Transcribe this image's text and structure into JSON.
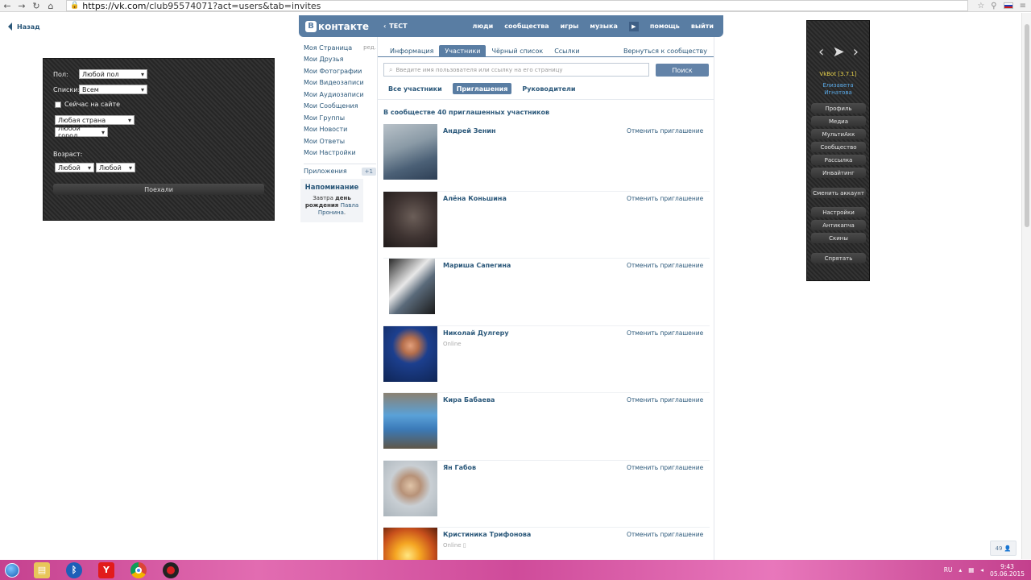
{
  "browser": {
    "url_domain": "https://vk.com",
    "url_path": "/club95574071?act=users&tab=invites"
  },
  "back": {
    "label": "Назад"
  },
  "filter": {
    "gender_label": "Пол:",
    "gender_value": "Любой пол",
    "lists_label": "Списки:",
    "lists_value": "Всем",
    "online_label": "Сейчас на сайте",
    "country_value": "Любая страна",
    "city_value": "Любой город",
    "age_label": "Возраст:",
    "age_from": "Любой",
    "age_to": "Любой",
    "go_label": "Поехали"
  },
  "vk": {
    "logo_letter": "В",
    "logo_text": "контакте",
    "group_name": "ТЕСТ",
    "nav": [
      "люди",
      "сообщества",
      "игры",
      "музыка",
      "помощь",
      "выйти"
    ],
    "menu": [
      "Моя Страница",
      "Мои Друзья",
      "Мои Фотографии",
      "Мои Видеозаписи",
      "Мои Аудиозаписи",
      "Мои Сообщения",
      "Мои Группы",
      "Мои Новости",
      "Мои Ответы",
      "Мои Настройки"
    ],
    "menu_edit": "ред.",
    "apps_label": "Приложения",
    "apps_badge": "+1",
    "reminder": {
      "title": "Напоминание",
      "line1_pre": "Завтра ",
      "line1_bold": "день",
      "line2_bold": "рождения ",
      "line2_link": "Павла",
      "line3_link": "Пронина",
      "line3_end": "."
    }
  },
  "main": {
    "tabs": [
      "Информация",
      "Участники",
      "Чёрный список",
      "Ссылки"
    ],
    "back_to_group": "Вернуться к сообществу",
    "search_placeholder": "Введите имя пользователя или ссылку на его страницу",
    "search_button": "Поиск",
    "subtabs": [
      "Все участники",
      "Приглашения",
      "Руководители"
    ],
    "count_text": "В сообществе 40 приглашенных участников",
    "cancel_label": "Отменить приглашение",
    "members": [
      {
        "name": "Андрей Зенин",
        "status": ""
      },
      {
        "name": "Алёна Коньшина",
        "status": ""
      },
      {
        "name": "Мариша Сапегина",
        "status": ""
      },
      {
        "name": "Николай Дулгеру",
        "status": "Online"
      },
      {
        "name": "Кира Бабаева",
        "status": ""
      },
      {
        "name": "Ян Габов",
        "status": ""
      },
      {
        "name": "Кристиника Трифонова",
        "status": "Online ▯"
      }
    ]
  },
  "vkbot": {
    "version": "VkBot [3.7.1]",
    "user_line1": "Елизавета",
    "user_line2": "Игнатова",
    "buttons": [
      "Профиль",
      "Медиа",
      "МультиАкк",
      "Сообщество",
      "Рассылка",
      "Инвайтинг",
      "Сменить аккаунт",
      "Настройки",
      "Антикапча",
      "Скины",
      "Спрятать"
    ]
  },
  "counter": "49 👤",
  "taskbar": {
    "lang": "RU",
    "time": "9:43",
    "date": "05.06.2015"
  },
  "colors": {
    "vk_blue": "#597da3",
    "link": "#2b587a",
    "taskbar_pink": "#d653a2"
  }
}
